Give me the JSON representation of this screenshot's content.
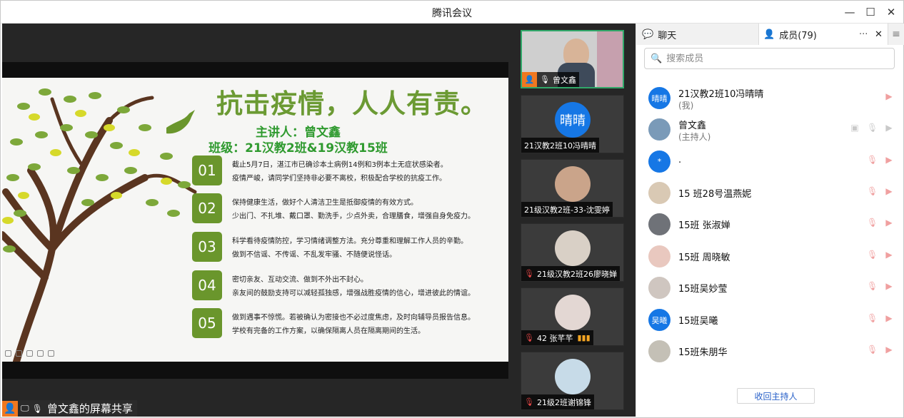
{
  "window": {
    "title": "腾讯会议",
    "controls": [
      "minimize",
      "maximize",
      "close"
    ]
  },
  "slide": {
    "title": "抗击疫情，人人有责。",
    "speaker": "主讲人：曾文鑫",
    "class": "班级：21汉教2班&19汉教15班",
    "items": [
      {
        "num": "01",
        "line1": "截止5月7日，湛江市已确诊本土病例14例和3例本土无症状感染者。",
        "line2": "疫情严峻，请同学们坚持非必要不离校，积极配合学校的抗疫工作。"
      },
      {
        "num": "02",
        "line1": "保持健康生活，做好个人清洁卫生是抵御疫情的有效方式。",
        "line2": "少出门、不扎堆、戴口罩、勤洗手，少点外卖，合理膳食，增强自身免疫力。"
      },
      {
        "num": "03",
        "line1": "科学看待疫情防控，学习情绪调整方法。充分尊重和理解工作人员的辛勤。",
        "line2": "做到不信谣、不传谣、不乱发牢骚、不随便说怪话。"
      },
      {
        "num": "04",
        "line1": "密切亲友、互动交流、做到不外出不封心。",
        "line2": "亲友间的鼓励支持可以减轻孤独感，增强战胜疫情的信心，增进彼此的情谊。"
      },
      {
        "num": "05",
        "line1": "做到遇事不惊慌。若被确认为密接也不必过度焦虑，及时向辅导员报告信息。",
        "line2": "学校有完备的工作方案，以确保隔离人员在隔离期间的生活。"
      }
    ]
  },
  "share_label": "曾文鑫的屏幕共享",
  "video_tiles": [
    {
      "name": "曾文鑫",
      "state": "active-speaking"
    },
    {
      "name": "21汉教2班10冯晴晴",
      "avatar_text": "晴晴"
    },
    {
      "name": "21级汉教2班-33-沈雯婷"
    },
    {
      "name": "21级汉教2班26廖晓婵",
      "muted": true
    },
    {
      "name": "42 张芊芊",
      "muted": true,
      "signal": "▮▮▮"
    },
    {
      "name": "21级2班谢锦锋",
      "muted": true
    }
  ],
  "panel": {
    "tab_chat": "聊天",
    "tab_members": "成员(79)",
    "more": "···",
    "close": "✕",
    "search_placeholder": "搜索成员",
    "reclaim_host": "收回主持人"
  },
  "members": [
    {
      "name": "21汉教2班10冯晴晴",
      "sub": "(我)",
      "avatar_text": "晴晴",
      "avatar_color": "#1677e5"
    },
    {
      "name": "曾文鑫",
      "sub": "(主持人)",
      "avatar_color": "#7a9ab8"
    },
    {
      "name": ".",
      "avatar_text": "*",
      "avatar_color": "#1677e5"
    },
    {
      "name": "15 班28号温燕妮",
      "avatar_color": "#d9c9b4"
    },
    {
      "name": "15班 张淑婵",
      "avatar_color": "#6f7278"
    },
    {
      "name": "15班 周晓敏",
      "avatar_color": "#e9c8bf"
    },
    {
      "name": "15班吴妙莹",
      "avatar_color": "#cfc6c0"
    },
    {
      "name": "15班吴曦",
      "avatar_text": "吴曦",
      "avatar_color": "#1677e5"
    },
    {
      "name": "15班朱朋华",
      "avatar_color": "#c4c0b6"
    }
  ]
}
